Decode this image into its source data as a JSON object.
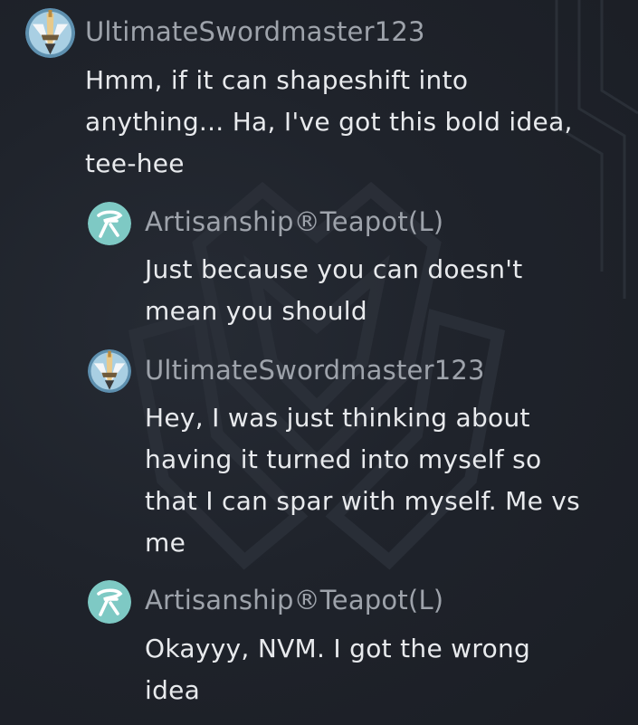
{
  "thread": {
    "comments": [
      {
        "username": "UltimateSwordmaster123",
        "avatar_icon": "sword-emblem-avatar-icon",
        "lines": [
          "Hmm, if it can shapeshift into",
          "anything... Ha, I've got this bold idea,",
          "tee-hee"
        ]
      },
      {
        "username": "Artisanship®Teapot(L)",
        "avatar_icon": "teapot-logo-avatar-icon",
        "lines": [
          "Just because you can doesn't",
          "mean you should"
        ]
      },
      {
        "username": "UltimateSwordmaster123",
        "avatar_icon": "sword-emblem-avatar-icon",
        "lines": [
          "Hey, I was just thinking about",
          "having it turned into myself so",
          "that I can spar with myself. Me vs",
          "me"
        ]
      },
      {
        "username": "Artisanship®Teapot(L)",
        "avatar_icon": "teapot-logo-avatar-icon",
        "lines": [
          "Okayyy, NVM. I got the wrong",
          "idea"
        ]
      }
    ]
  },
  "colors": {
    "background": "#1f232b",
    "username": "#9ea3ab",
    "text": "#e8eaed",
    "teapot_avatar_bg": "#7ec9c4"
  }
}
